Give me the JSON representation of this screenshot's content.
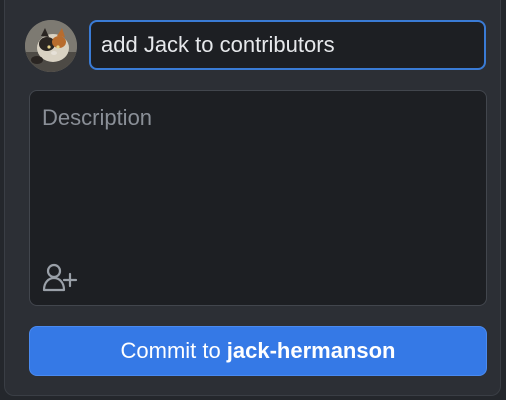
{
  "commit_form": {
    "summary_value": "add Jack to contributors",
    "description_placeholder": "Description",
    "commit_button": {
      "prefix": "Commit to",
      "branch": "jack-hermanson"
    }
  },
  "icons": {
    "avatar": "user-avatar-cat-photo",
    "coauthor": "add-coauthor-person-plus-icon"
  },
  "colors": {
    "panel_bg": "#2c2f35",
    "field_bg": "#1d1f23",
    "focus_border": "#3a7bd5",
    "button_bg": "#3579e6",
    "placeholder_text": "#8a8f97"
  }
}
